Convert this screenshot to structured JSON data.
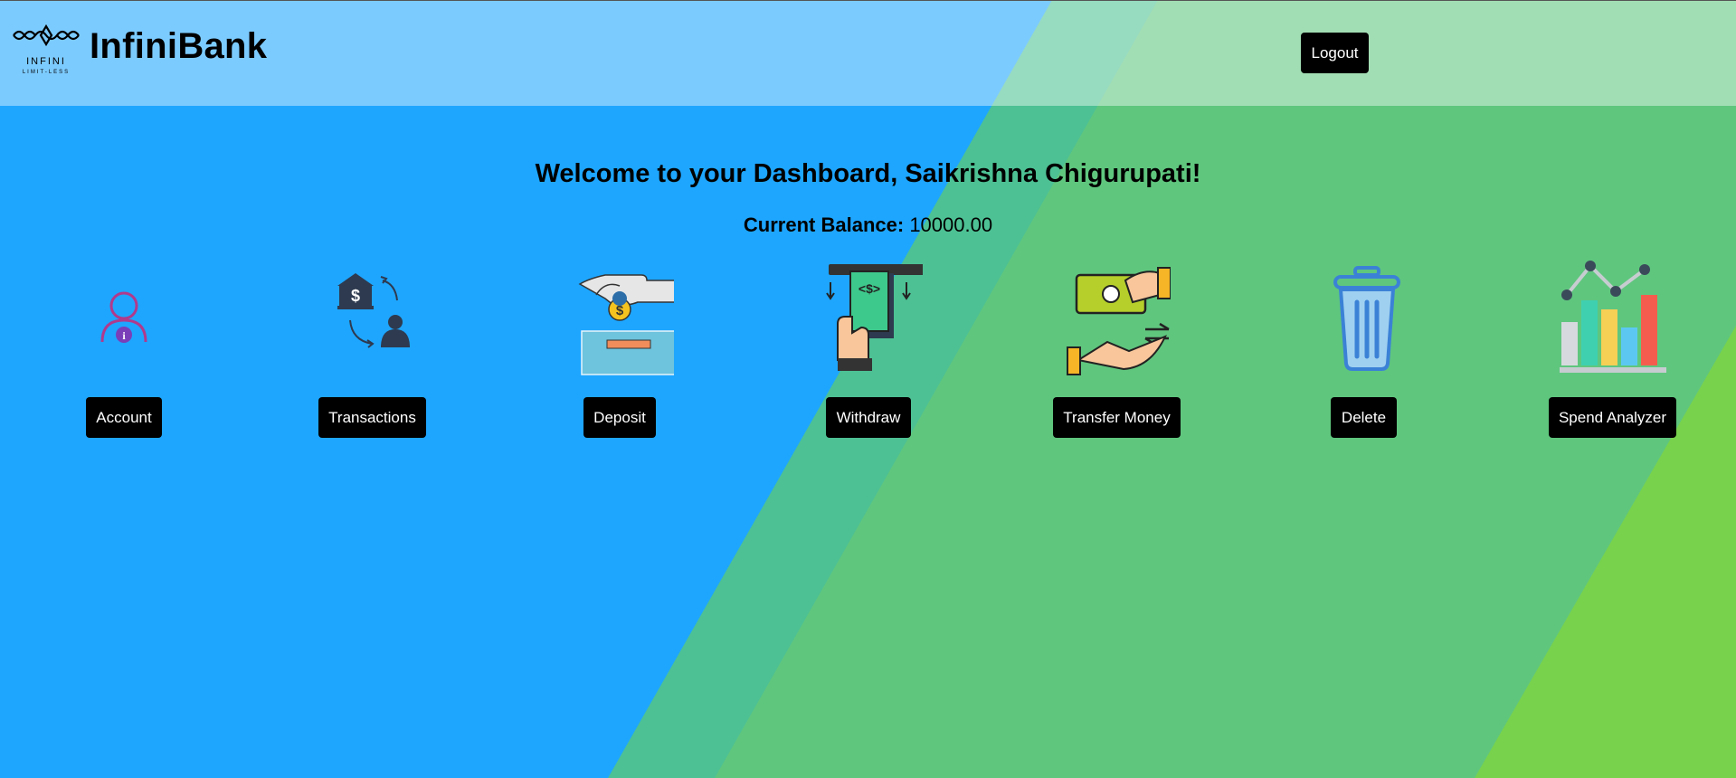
{
  "header": {
    "logo_title": "INFINI",
    "logo_subtitle": "LIMIT-LESS",
    "brand": "InfiniBank",
    "logout_label": "Logout"
  },
  "main": {
    "welcome": "Welcome to your Dashboard, Saikrishna Chigurupati!",
    "balance_label": "Current Balance:",
    "balance_value": "10000.00"
  },
  "actions": [
    {
      "label": "Account",
      "icon": "account-icon"
    },
    {
      "label": "Transactions",
      "icon": "transactions-icon"
    },
    {
      "label": "Deposit",
      "icon": "deposit-icon"
    },
    {
      "label": "Withdraw",
      "icon": "withdraw-icon"
    },
    {
      "label": "Transfer Money",
      "icon": "transfer-money-icon"
    },
    {
      "label": "Delete",
      "icon": "trash-icon"
    },
    {
      "label": "Spend Analyzer",
      "icon": "spend-analyzer-icon"
    }
  ],
  "colors": {
    "bg_blue": "#1ea6ff",
    "bg_green": "#5fc67e",
    "bg_lime": "#78d24c",
    "header_overlay": "#ffffff",
    "button": "#000000"
  }
}
